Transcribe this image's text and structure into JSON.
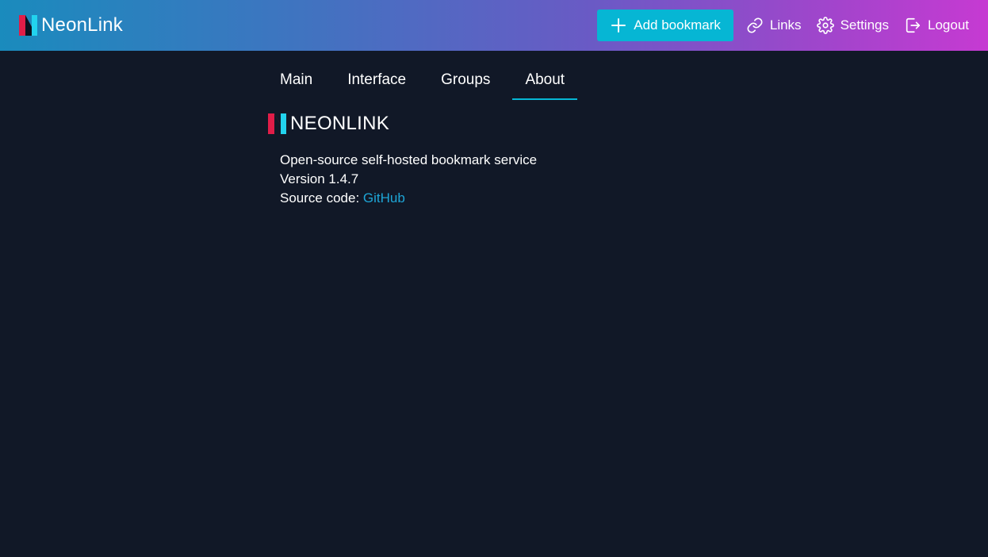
{
  "header": {
    "brand": "NeonLink",
    "add_bookmark_label": "Add bookmark",
    "links_label": "Links",
    "settings_label": "Settings",
    "logout_label": "Logout",
    "icons": [
      "plus-icon",
      "link-icon",
      "gear-icon",
      "logout-icon"
    ],
    "accent_color": "#06b6d4"
  },
  "tabs": [
    {
      "label": "Main",
      "active": false
    },
    {
      "label": "Interface",
      "active": false
    },
    {
      "label": "Groups",
      "active": false
    },
    {
      "label": "About",
      "active": true
    }
  ],
  "about": {
    "logo_text": "NEONLINK",
    "description": "Open-source self-hosted bookmark service",
    "version": "Version 1.4.7",
    "source_label": "Source code:",
    "source_link_text": "GitHub"
  }
}
